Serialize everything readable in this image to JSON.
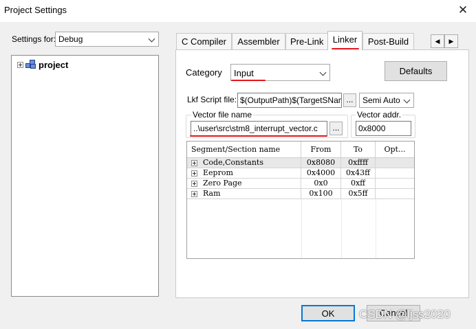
{
  "window": {
    "title": "Project Settings",
    "close_glyph": "✕"
  },
  "settings_for": {
    "label": "Settings for:",
    "value": "Debug"
  },
  "tree": {
    "root_label": "project"
  },
  "tabs": [
    {
      "label": "C Compiler"
    },
    {
      "label": "Assembler"
    },
    {
      "label": "Pre-Link"
    },
    {
      "label": "Linker",
      "active": true
    },
    {
      "label": "Post-Build"
    }
  ],
  "tab_scroll": {
    "left": "◀",
    "right": "▶"
  },
  "linker": {
    "category_label": "Category",
    "category_value": "Input",
    "defaults_label": "Defaults",
    "lkf_label": "Lkf Script file:",
    "lkf_value": "$(OutputPath)$(TargetSName",
    "lkf_browse": "...",
    "lkf_mode": "Semi Auto",
    "vector_file_label": "Vector file name",
    "vector_file_value": "..\\user\\src\\stm8_interrupt_vector.c",
    "vector_browse": "...",
    "vector_addr_label": "Vector addr.",
    "vector_addr_value": "0x8000"
  },
  "segments": {
    "headers": [
      "Segment/Section name",
      "From",
      "To",
      "Opt..."
    ],
    "rows": [
      {
        "name": "Code,Constants",
        "from": "0x8080",
        "to": "0xffff",
        "opt": ""
      },
      {
        "name": "Eeprom",
        "from": "0x4000",
        "to": "0x43ff",
        "opt": ""
      },
      {
        "name": "Zero Page",
        "from": "0x0",
        "to": "0xff",
        "opt": ""
      },
      {
        "name": "Ram",
        "from": "0x100",
        "to": "0x5ff",
        "opt": ""
      }
    ]
  },
  "footer": {
    "ok_label": "OK",
    "cancel_label": "Cancel"
  },
  "watermark": "CSDN @ljss2020",
  "colors": {
    "annotation_red": "#e4141b",
    "focus_blue": "#0078d7"
  }
}
